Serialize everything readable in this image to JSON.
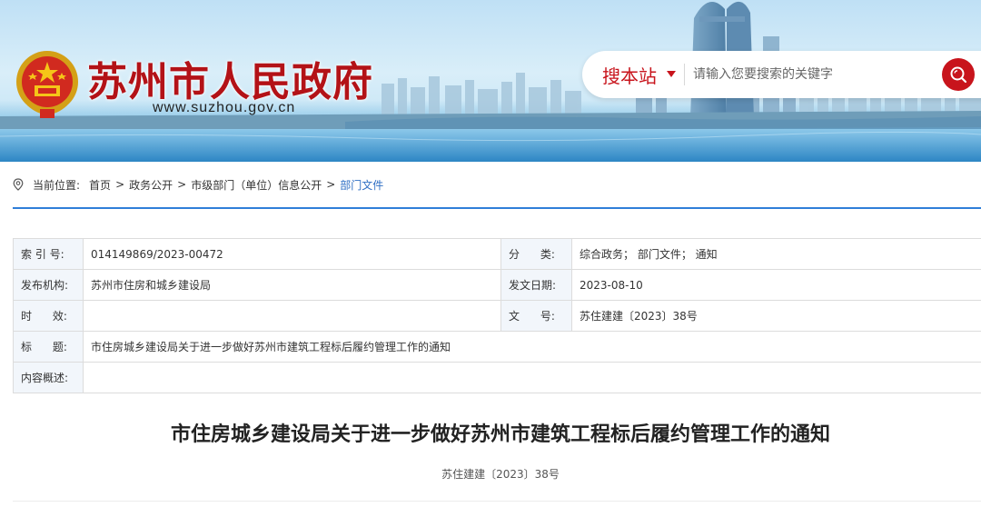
{
  "header": {
    "site_title": "苏州市人民政府",
    "site_url": "www.suzhou.gov.cn",
    "search": {
      "scope_label": "搜本站",
      "placeholder": "请输入您要搜索的关键字"
    }
  },
  "breadcrumb": {
    "prefix": "当前位置:",
    "items": [
      "首页",
      "政务公开",
      "市级部门（单位）信息公开",
      "部门文件"
    ],
    "separator": ">"
  },
  "info_table": {
    "rows": [
      {
        "label": "索 引 号:",
        "value": "014149869/2023-00472",
        "label2": "分      类:",
        "value2": "综合政务；  部门文件；  通知"
      },
      {
        "label": "发布机构:",
        "value": "苏州市住房和城乡建设局",
        "label2": "发文日期:",
        "value2": "2023-08-10"
      },
      {
        "label": "时      效:",
        "value": "",
        "label2": "文      号:",
        "value2": "苏住建建〔2023〕38号"
      },
      {
        "label": "标      题:",
        "value": "市住房城乡建设局关于进一步做好苏州市建筑工程标后履约管理工作的通知"
      },
      {
        "label": "内容概述:",
        "value": ""
      }
    ]
  },
  "article": {
    "title": "市住房城乡建设局关于进一步做好苏州市建筑工程标后履约管理工作的通知",
    "doc_no": "苏住建建〔2023〕38号"
  },
  "colors": {
    "brand_red": "#b31217",
    "accent_red": "#c8141c",
    "link_blue": "#2f6fc4",
    "rule_blue": "#2f7ed8",
    "label_bg": "#f2f6fb"
  },
  "icons": {
    "emblem": "national-emblem-icon",
    "search": "search-icon",
    "location": "location-pin-icon",
    "caret": "caret-down-icon"
  }
}
